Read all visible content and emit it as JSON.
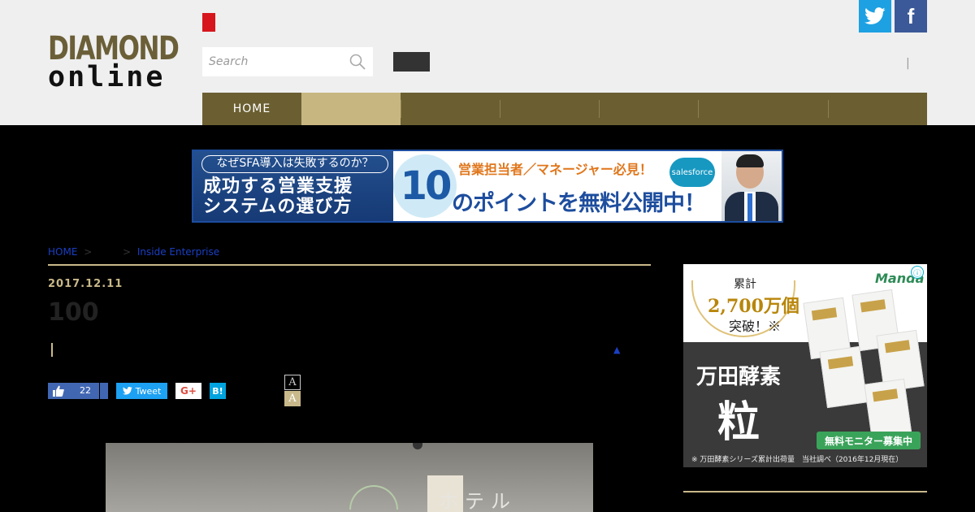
{
  "header": {
    "logo": {
      "line1": "DIAMOND",
      "line2": "online"
    },
    "search": {
      "placeholder": "Search"
    },
    "separator": "|",
    "social": {
      "twitter_icon": "twitter-bird-icon",
      "facebook_glyph": "f"
    }
  },
  "nav": {
    "items": [
      {
        "label": "HOME",
        "active": false
      },
      {
        "label": "",
        "active": true
      },
      {
        "label": "",
        "active": false
      },
      {
        "label": "",
        "active": false
      },
      {
        "label": "",
        "active": false
      },
      {
        "label": "",
        "active": false
      },
      {
        "label": "",
        "active": false
      }
    ]
  },
  "banner": {
    "pill": "なぜSFA導入は失敗するのか？",
    "main_line1": "成功する営業支援",
    "main_line2": "システムの選び方",
    "ten": "10",
    "sub": "営業担当者／マネージャー必見！",
    "head": "のポイントを無料公開中！",
    "sf_logo": "salesforce"
  },
  "article": {
    "breadcrumb": {
      "home": "HOME",
      "sep1": ">",
      "sep2": ">",
      "section": "Inside Enterprise"
    },
    "date": "2017.12.11",
    "headline": "100",
    "back_to_top": "▲",
    "share": {
      "like_count": "22",
      "tweet_label": "Tweet",
      "gplus_label": "G+",
      "hatena_label": "B!"
    },
    "font_size_a_small": "A",
    "font_size_a_large": "A",
    "photo_sign": "ホテル"
  },
  "side_ad": {
    "cumulative": "累計",
    "number": "2,700万個",
    "break": "突破！※",
    "brand": "Manda",
    "close": "ⓘ",
    "product_name": "万田酵素",
    "grain": "粒",
    "monitor": "無料モニター募集中",
    "note": "※ 万田酵素シリーズ累計出荷量　当社調べ（2016年12月現在）"
  },
  "colors": {
    "header_bg": "#efefef",
    "nav_bg": "#6b5f32",
    "nav_active": "#c8b680",
    "accent_gold": "#c9b98a",
    "twitter": "#1da1e2",
    "facebook": "#3b5998",
    "red_tab": "#d6161c"
  }
}
